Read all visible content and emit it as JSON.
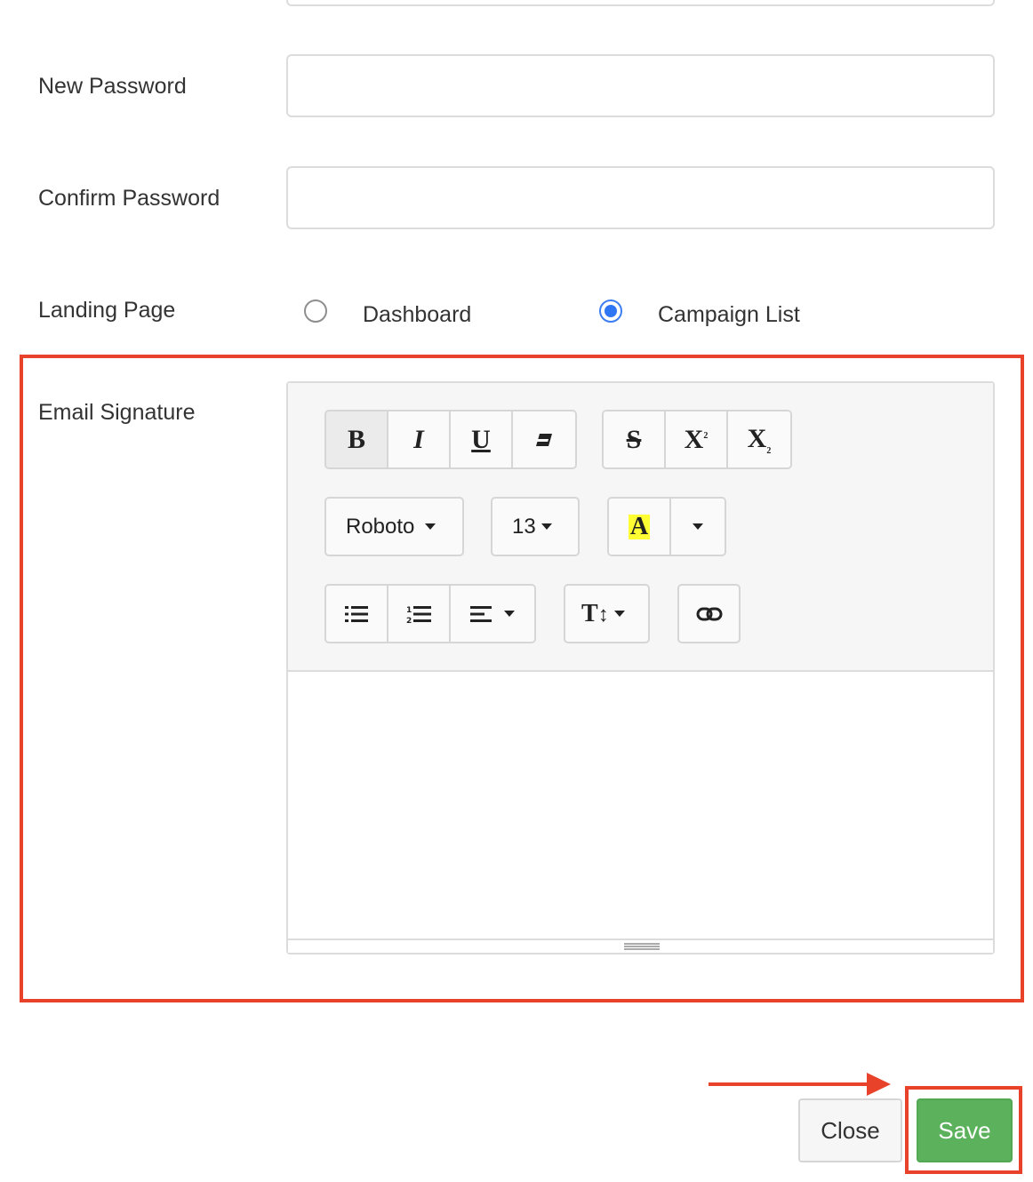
{
  "form": {
    "new_password_label": "New Password",
    "confirm_password_label": "Confirm Password",
    "landing_page_label": "Landing Page",
    "landing_options": [
      {
        "label": "Dashboard",
        "checked": false
      },
      {
        "label": "Campaign List",
        "checked": true
      }
    ],
    "email_signature_label": "Email Signature"
  },
  "editor": {
    "font_family": "Roboto",
    "font_size": "13",
    "buttons": {
      "bold": "B",
      "italic": "I",
      "underline": "U",
      "strikethrough": "S",
      "superscript": "X",
      "subscript": "X",
      "color": "A",
      "line_height": "T"
    },
    "icons": [
      "bold-icon",
      "italic-icon",
      "underline-icon",
      "eraser-icon",
      "strikethrough-icon",
      "superscript-icon",
      "subscript-icon",
      "text-color-icon",
      "bullet-list-icon",
      "numbered-list-icon",
      "align-icon",
      "line-height-icon",
      "link-icon"
    ]
  },
  "actions": {
    "close_label": "Close",
    "save_label": "Save"
  },
  "colors": {
    "annotation": "#e8432a",
    "save": "#5cb25c",
    "radio_selected": "#2f76f5",
    "highlight": "#ffff33"
  }
}
